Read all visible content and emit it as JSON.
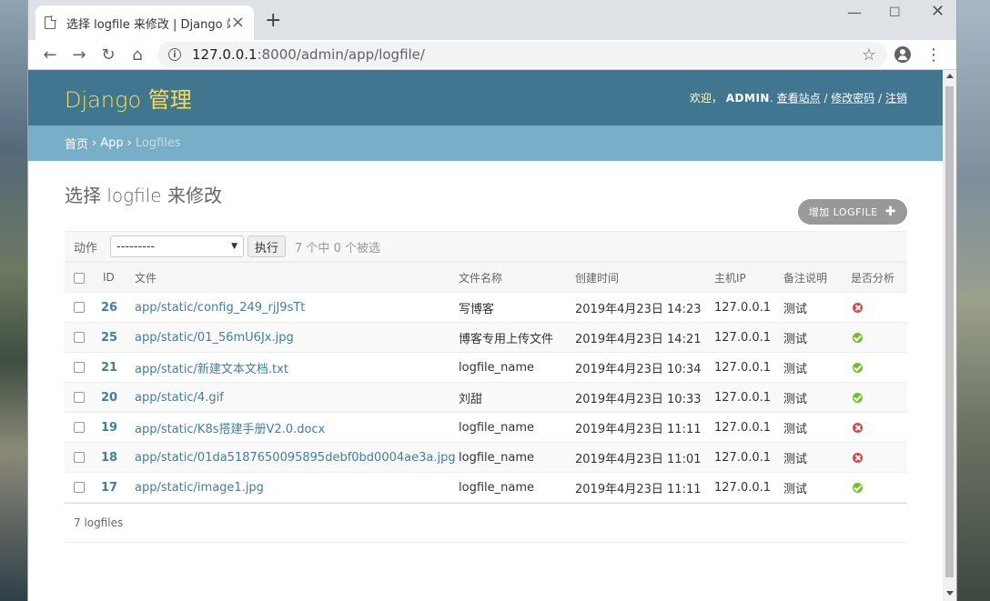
{
  "browser": {
    "tab_title": "选择 logfile 来修改 | Django 站",
    "url_host": "127.0.0.1",
    "url_path": ":8000/admin/app/logfile/"
  },
  "header": {
    "brand": "Django 管理",
    "welcome": "欢迎，",
    "username": "ADMIN",
    "view_site": "查看站点",
    "change_password": "修改密码",
    "logout": "注销"
  },
  "breadcrumbs": {
    "home": "首页",
    "app": "App",
    "current": "Logfiles"
  },
  "content": {
    "title": "选择 logfile 来修改",
    "add_button": "增加 LOGFILE"
  },
  "actions": {
    "label": "动作",
    "selected_option": "---------",
    "go_button": "执行",
    "selection_count": "7 个中 0 个被选"
  },
  "table": {
    "headers": [
      "ID",
      "文件",
      "文件名称",
      "创建时间",
      "主机IP",
      "备注说明",
      "是否分析"
    ],
    "rows": [
      {
        "id": "26",
        "file": "app/static/config_249_rjJ9sTt",
        "name": "写博客",
        "created": "2019年4月23日 14:23",
        "ip": "127.0.0.1",
        "note": "测试",
        "analyzed": false
      },
      {
        "id": "25",
        "file": "app/static/01_56mU6Jx.jpg",
        "name": "博客专用上传文件",
        "created": "2019年4月23日 14:21",
        "ip": "127.0.0.1",
        "note": "测试",
        "analyzed": true
      },
      {
        "id": "21",
        "file": "app/static/新建文本文档.txt",
        "name": "logfile_name",
        "created": "2019年4月23日 10:34",
        "ip": "127.0.0.1",
        "note": "测试",
        "analyzed": true
      },
      {
        "id": "20",
        "file": "app/static/4.gif",
        "name": "刘甜",
        "created": "2019年4月23日 10:33",
        "ip": "127.0.0.1",
        "note": "测试",
        "analyzed": true
      },
      {
        "id": "19",
        "file": "app/static/K8s搭建手册V2.0.docx",
        "name": "logfile_name",
        "created": "2019年4月23日 11:11",
        "ip": "127.0.0.1",
        "note": "测试",
        "analyzed": false
      },
      {
        "id": "18",
        "file": "app/static/01da5187650095895debf0bd0004ae3a.jpg",
        "name": "logfile_name",
        "created": "2019年4月23日 11:01",
        "ip": "127.0.0.1",
        "note": "测试",
        "analyzed": false
      },
      {
        "id": "17",
        "file": "app/static/image1.jpg",
        "name": "logfile_name",
        "created": "2019年4月23日 11:11",
        "ip": "127.0.0.1",
        "note": "测试",
        "analyzed": true
      }
    ]
  },
  "paginator": {
    "text": "7 logfiles"
  }
}
